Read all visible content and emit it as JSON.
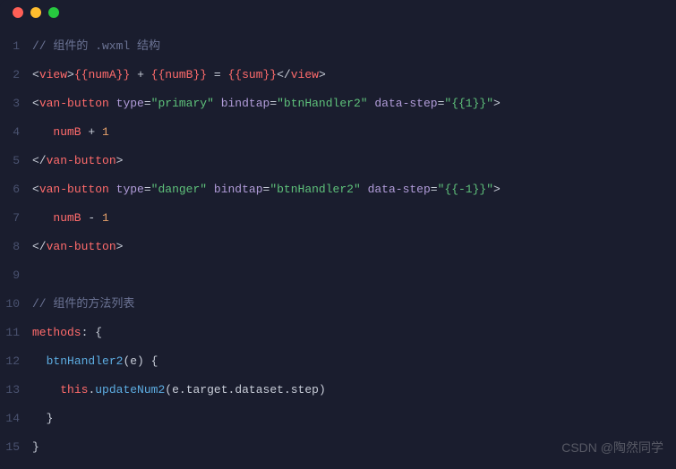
{
  "watermark": "CSDN @陶然同学",
  "lines": {
    "n1": "1",
    "n2": "2",
    "n3": "3",
    "n4": "4",
    "n5": "5",
    "n6": "6",
    "n7": "7",
    "n8": "8",
    "n9": "9",
    "n10": "10",
    "n11": "11",
    "n12": "12",
    "n13": "13",
    "n14": "14",
    "n15": "15"
  },
  "code": {
    "l1": {
      "comment": "// 组件的 .wxml 结构"
    },
    "l2": {
      "open_lt": "<",
      "tag": "view",
      "gt": ">",
      "numA": "{{numA}}",
      "plus": " + ",
      "numB": "{{numB}}",
      "eq": " = ",
      "sum": "{{sum}}",
      "close_lt": "</",
      "close_gt": ">"
    },
    "l3": {
      "open_lt": "<",
      "tag": "van-button",
      "sp": " ",
      "attr_type": "type",
      "eq1": "=",
      "val_type": "\"primary\"",
      "attr_bind": "bindtap",
      "eq2": "=",
      "val_bind": "\"btnHandler2\"",
      "attr_data": "data-step",
      "eq3": "=",
      "val_data": "\"{{1}}\"",
      "gt": ">"
    },
    "l4": {
      "indent": "   ",
      "numB": "numB",
      "op": " + ",
      "one": "1"
    },
    "l5": {
      "close_lt": "</",
      "tag": "van-button",
      "gt": ">"
    },
    "l6": {
      "open_lt": "<",
      "tag": "van-button",
      "sp": " ",
      "attr_type": "type",
      "eq1": "=",
      "val_type": "\"danger\"",
      "attr_bind": "bindtap",
      "eq2": "=",
      "val_bind": "\"btnHandler2\"",
      "attr_data": "data-step",
      "eq3": "=",
      "val_data": "\"{{-1}}\"",
      "gt": ">"
    },
    "l7": {
      "indent": "   ",
      "numB": "numB",
      "op": " - ",
      "one": "1"
    },
    "l8": {
      "close_lt": "</",
      "tag": "van-button",
      "gt": ">"
    },
    "l9": {
      "blank": ""
    },
    "l10": {
      "comment": "// 组件的方法列表"
    },
    "l11": {
      "methods": "methods",
      "rest": ": {"
    },
    "l12": {
      "indent": "  ",
      "fn": "btnHandler2",
      "params": "(e) {"
    },
    "l13": {
      "indent": "    ",
      "this": "this",
      "dot1": ".",
      "update": "updateNum2",
      "open": "(",
      "e": "e",
      "d2": ".",
      "target": "target",
      "d3": ".",
      "dataset": "dataset",
      "d4": ".",
      "step": "step",
      "close": ")"
    },
    "l14": {
      "indent": "  ",
      "brace": "}"
    },
    "l15": {
      "brace": "}"
    }
  }
}
